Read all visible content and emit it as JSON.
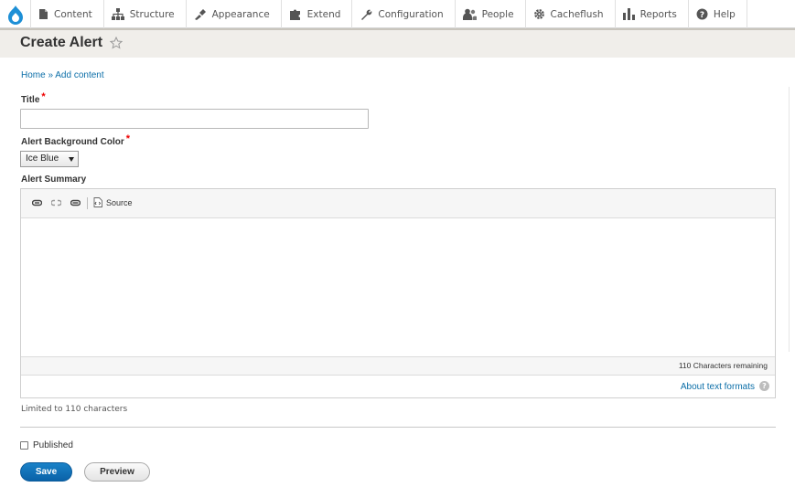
{
  "toolbar": {
    "logo_icon": "drupal-drop-icon",
    "items": [
      {
        "label": "Content",
        "icon": "file-icon"
      },
      {
        "label": "Structure",
        "icon": "sitemap-icon"
      },
      {
        "label": "Appearance",
        "icon": "brush-icon"
      },
      {
        "label": "Extend",
        "icon": "puzzle-icon"
      },
      {
        "label": "Configuration",
        "icon": "wrench-icon"
      },
      {
        "label": "People",
        "icon": "people-icon"
      },
      {
        "label": "Cacheflush",
        "icon": "gear-icon"
      },
      {
        "label": "Reports",
        "icon": "bar-chart-icon"
      },
      {
        "label": "Help",
        "icon": "question-icon"
      }
    ]
  },
  "header": {
    "title": "Create Alert",
    "star_icon": "star-outline-icon"
  },
  "breadcrumb": {
    "home": "Home",
    "separator": "»",
    "current": "Add content"
  },
  "form": {
    "title_label": "Title",
    "title_value": "",
    "required_mark": "*",
    "color_label": "Alert Background Color",
    "color_value": "Ice Blue",
    "summary_label": "Alert Summary",
    "source_label": "Source",
    "chars_remaining": "110 Characters remaining",
    "about_formats": "About text formats",
    "help_glyph": "?",
    "limit_text": "Limited to 110 characters",
    "published_label": "Published",
    "published_checked": false,
    "save_label": "Save",
    "preview_label": "Preview"
  },
  "colors": {
    "accent": "#0a62a8",
    "link": "#0b6ea8",
    "required": "#ee0000",
    "header_bg": "#f0eeea"
  }
}
